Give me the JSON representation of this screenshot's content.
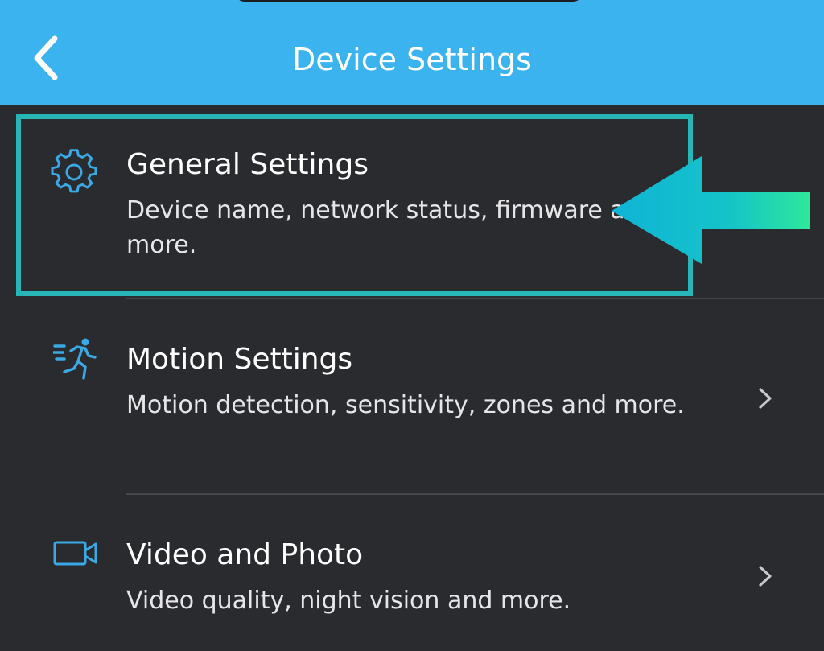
{
  "header": {
    "title": "Device Settings",
    "back_icon": "chevron-left-icon",
    "background_color": "#3bb3ee"
  },
  "settings": [
    {
      "title": "General Settings",
      "description": "Device name, network status, firmware and more.",
      "icon": "gear-icon"
    },
    {
      "title": "Motion Settings",
      "description": "Motion detection, sensitivity, zones and more.",
      "icon": "running-person-icon",
      "has_chevron": true
    },
    {
      "title": "Video and Photo",
      "description": "Video quality, night vision and more.",
      "icon": "video-camera-icon",
      "has_chevron": true
    }
  ],
  "annotation": {
    "highlight_color": "#27b5b7",
    "arrow_colors": [
      "#10b4d6",
      "#2ee89a"
    ],
    "target": "General Settings"
  },
  "colors": {
    "background": "#2a2b2f",
    "icon_accent": "#3aa9e6"
  }
}
